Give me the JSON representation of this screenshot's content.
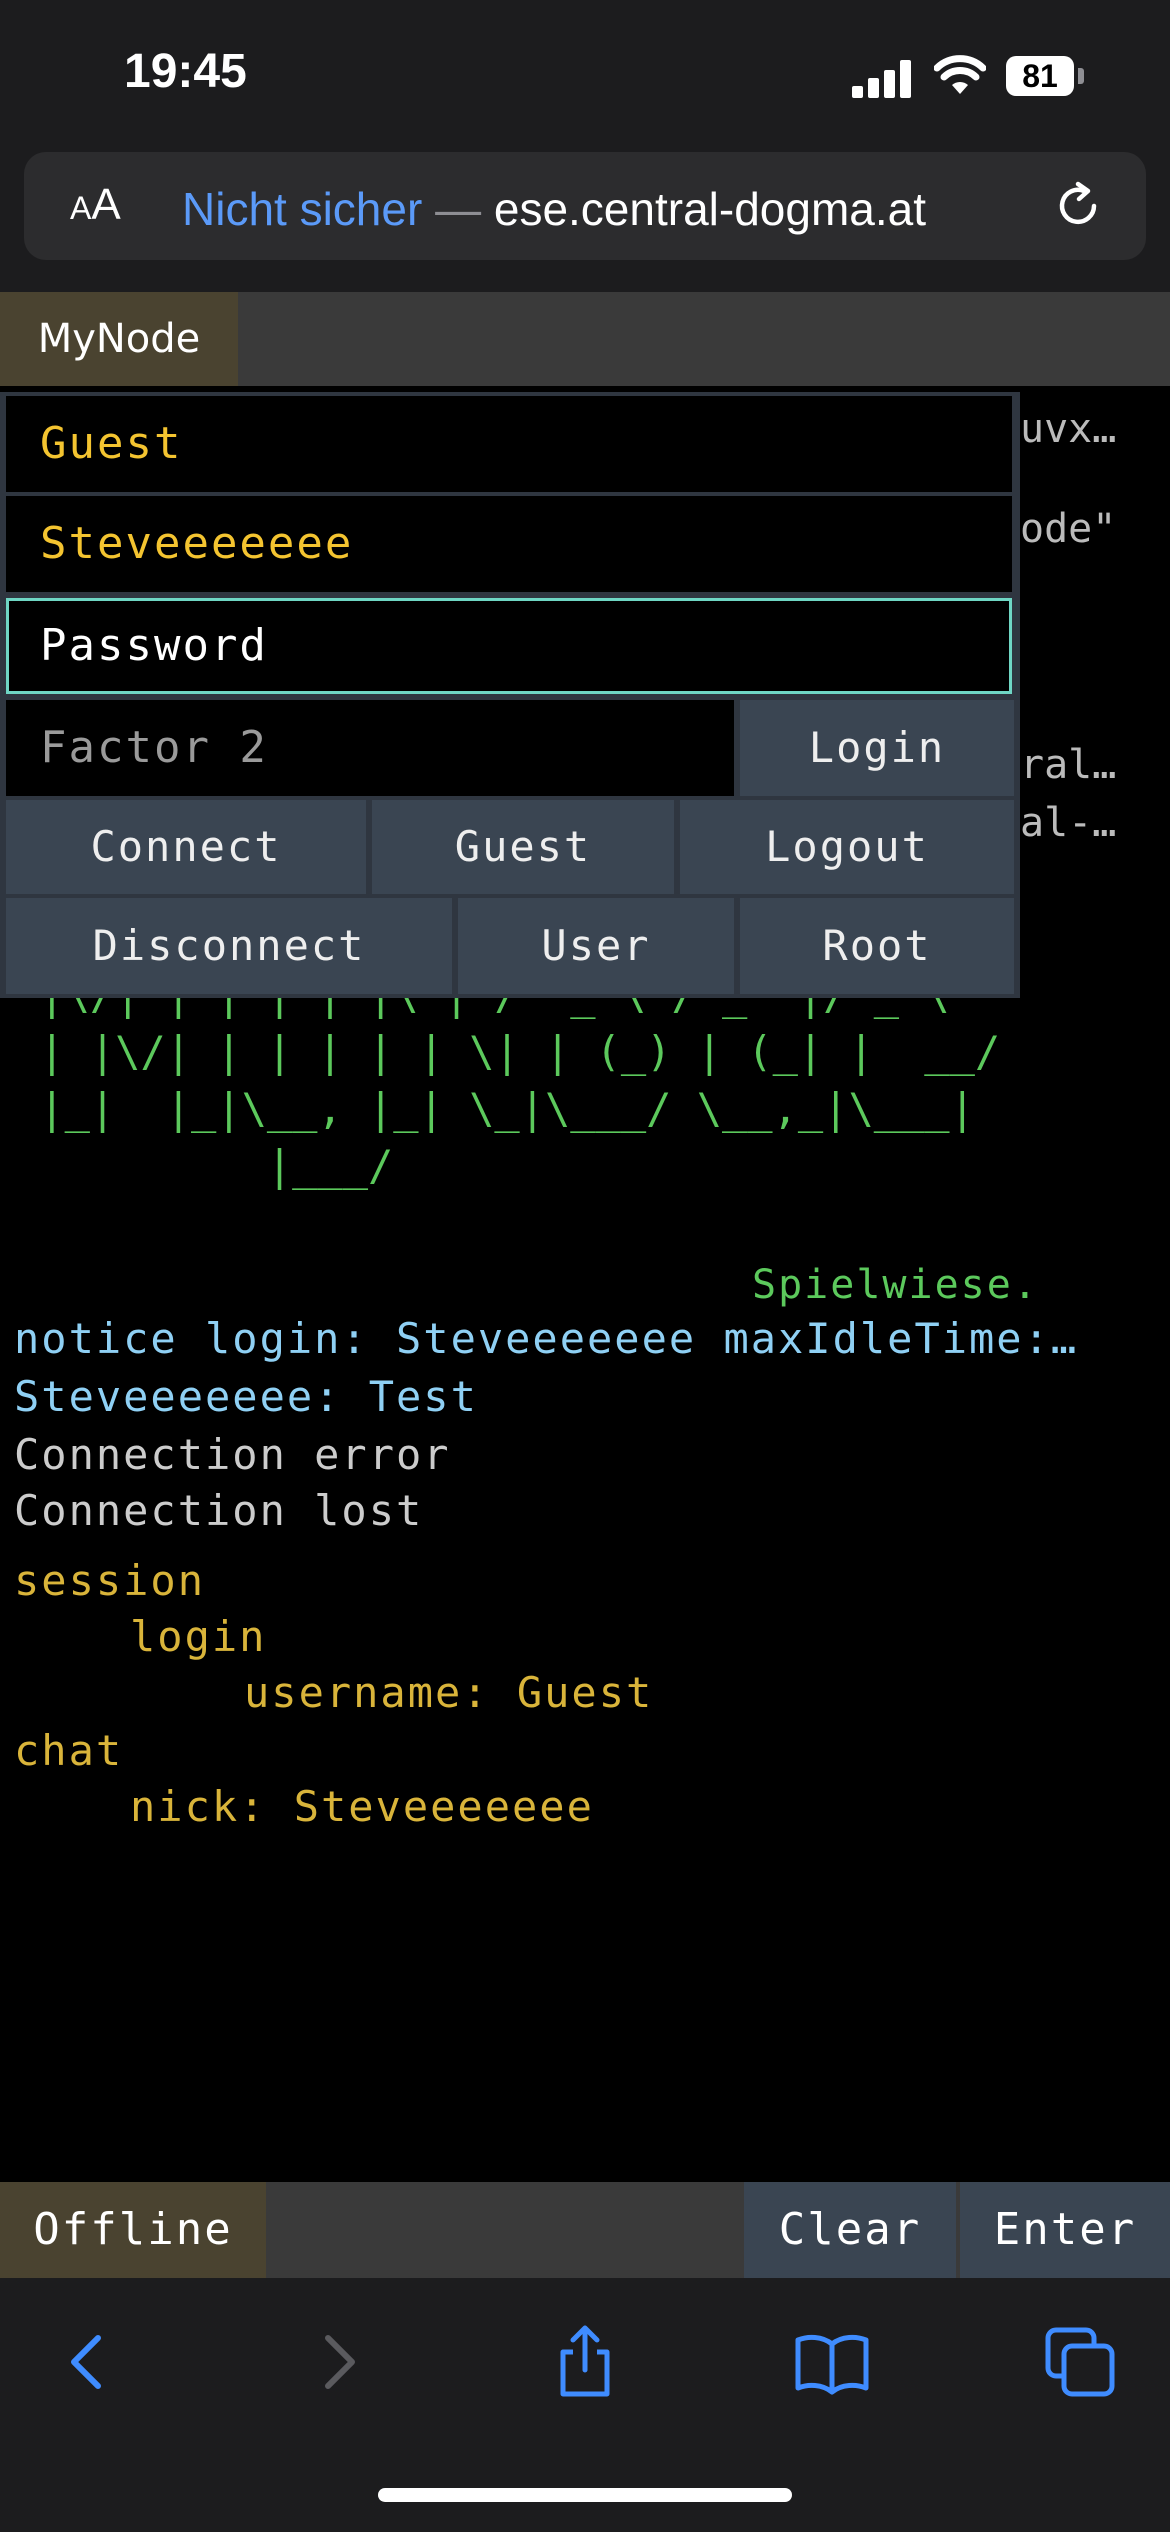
{
  "status_bar": {
    "time": "19:45",
    "battery": "81"
  },
  "browser": {
    "aa_small": "A",
    "aa_large": "A",
    "insecure_label": "Nicht sicher",
    "separator": " — ",
    "host": "ese.central-dogma.at"
  },
  "topbar": {
    "tab_label": "MyNode"
  },
  "login_panel": {
    "field_1": "Guest",
    "field_2": "Steveeeeeee",
    "password_placeholder": "Password",
    "factor2_placeholder": "Factor 2",
    "login_button": "Login",
    "connect_button": "Connect",
    "guest_button": "Guest",
    "logout_button": "Logout",
    "disconnect_button": "Disconnect",
    "user_button": "User",
    "root_button": "Root"
  },
  "terminal": {
    "right_fragments": [
      "uvx…",
      "ode\"",
      "ral…",
      "al-…"
    ],
    "ascii_art": " |\\/| | | | | |\\ | /  _ \\ / _` |/ _ \\\n | |\\/| | | | | | \\| | (_) | (_| |  __/\n |_|  |_|\\__, |_| \\_|\\___/ \\__,_|\\___|\n          |___/",
    "tagline": "Spielwiese.",
    "notice_line": "notice login: Steveeeeeee maxIdleTime:…",
    "chat_line": "Steveeeeeee: Test",
    "error_line_1": "Connection error",
    "error_line_2": "Connection lost",
    "tree": {
      "session": "session",
      "login": "login",
      "username": "username: Guest",
      "chat": "chat",
      "nick": "nick: Steveeeeeee"
    }
  },
  "bottombar": {
    "status": "Offline",
    "clear_button": "Clear",
    "enter_button": "Enter"
  },
  "colors": {
    "accent_blue": "#5b9af8",
    "yellow": "#f4c430",
    "green": "#5cc95c",
    "light_blue": "#8fd0f4",
    "focus_border": "#6fd6c4"
  }
}
